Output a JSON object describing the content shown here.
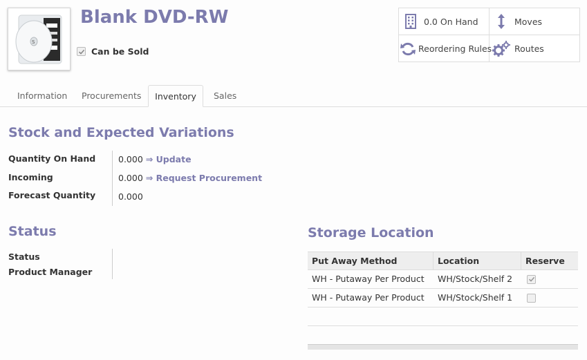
{
  "product": {
    "name": "Blank DVD-RW",
    "can_be_sold_label": "Can be Sold",
    "can_be_sold": true
  },
  "smart_buttons": [
    {
      "label": "0.0 On Hand",
      "icon": "building-icon"
    },
    {
      "label": "Moves",
      "icon": "vertical-arrows-icon"
    },
    {
      "label": "Reordering Rules",
      "icon": "refresh-icon"
    },
    {
      "label": "Routes",
      "icon": "gears-icon"
    }
  ],
  "tabs": [
    {
      "label": "Information",
      "active": false
    },
    {
      "label": "Procurements",
      "active": false
    },
    {
      "label": "Inventory",
      "active": true
    },
    {
      "label": "Sales",
      "active": false
    }
  ],
  "stock": {
    "title": "Stock and Expected Variations",
    "qty_on_hand_label": "Quantity On Hand",
    "qty_on_hand_value": "0.000",
    "update_link": "⇒ Update",
    "incoming_label": "Incoming",
    "incoming_value": "0.000",
    "request_link": "⇒ Request Procurement",
    "forecast_label": "Forecast Quantity",
    "forecast_value": "0.000"
  },
  "status": {
    "title": "Status",
    "status_label": "Status",
    "manager_label": "Product Manager"
  },
  "storage": {
    "title": "Storage Location",
    "columns": [
      "Put Away Method",
      "Location",
      "Reserve"
    ],
    "rows": [
      {
        "method": "WH - Putaway Per Product",
        "location": "WH/Stock/Shelf 2",
        "reserve": true
      },
      {
        "method": "WH - Putaway Per Product",
        "location": "WH/Stock/Shelf 1",
        "reserve": false
      }
    ]
  },
  "colors": {
    "accent": "#7c7bad",
    "icon": "#7c7bad"
  }
}
